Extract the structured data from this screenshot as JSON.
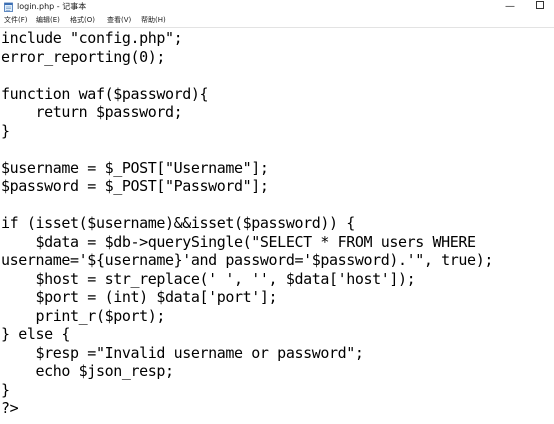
{
  "window": {
    "title": "login.php - 记事本",
    "minimize_glyph": "—"
  },
  "menu": {
    "items": [
      {
        "label": "文件(F)"
      },
      {
        "label": "编辑(E)"
      },
      {
        "label": "格式(O)"
      },
      {
        "label": "查看(V)"
      },
      {
        "label": "帮助(H)"
      }
    ]
  },
  "editor": {
    "lines": [
      "include \"config.php\";",
      "error_reporting(0);",
      "",
      "function waf($password){",
      "    return $password;",
      "}",
      "",
      "$username = $_POST[\"Username\"];",
      "$password = $_POST[\"Password\"];",
      "",
      "if (isset($username)&&isset($password)) {",
      "    $data = $db->querySingle(\"SELECT * FROM users WHERE",
      "username='${username}'and password='$password).'\", true);",
      "    $host = str_replace(' ', '', $data['host']);",
      "    $port = (int) $data['port'];",
      "    print_r($port);",
      "} else {",
      "    $resp =\"Invalid username or password\";",
      "    echo $json_resp;",
      "}",
      "?>"
    ]
  }
}
